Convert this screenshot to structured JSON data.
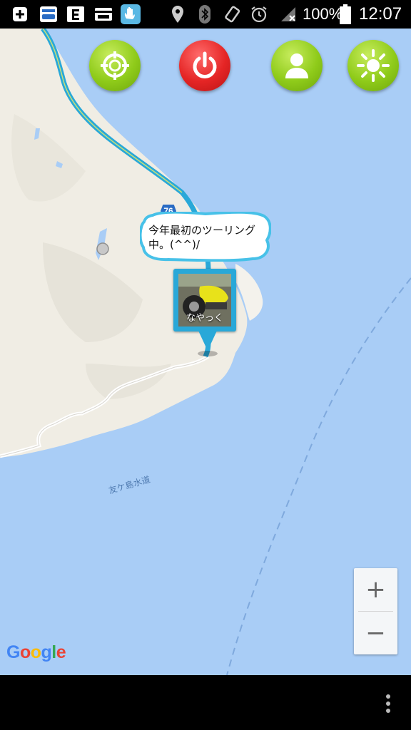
{
  "status_bar": {
    "battery_percent": "100%",
    "time": "12:07",
    "left_icons": [
      "add-box-icon",
      "drivers-app-icon",
      "e-app-icon",
      "pass-app-icon",
      "hand-app-icon"
    ],
    "right_icons": [
      "location-pin-icon",
      "bluetooth-icon",
      "vibrate-icon",
      "alarm-icon",
      "signal-icon",
      "battery-icon"
    ]
  },
  "toolbar": {
    "buttons": [
      {
        "name": "target-locate-button",
        "icon": "crosshair-icon",
        "color": "#8fcb1a"
      },
      {
        "name": "power-button",
        "icon": "power-icon",
        "color": "#e52525"
      },
      {
        "name": "profile-button",
        "icon": "person-icon",
        "color": "#8fcb1a"
      },
      {
        "name": "brightness-button",
        "icon": "sun-icon",
        "color": "#8fcb1a"
      }
    ]
  },
  "map": {
    "road_shield": "76",
    "strait_label": "友ケ島水道",
    "speech_bubble": "今年最初のツーリング中。(^^)/",
    "marker_name": "なやっく",
    "attribution": "Google",
    "water_color": "#a9cdf6",
    "land_color": "#f0ede4",
    "route_color": "#29a8d8"
  },
  "zoom": {
    "in_label": "+",
    "out_label": "−"
  },
  "nav_bar": {
    "menu_icon": "overflow-menu-icon"
  }
}
